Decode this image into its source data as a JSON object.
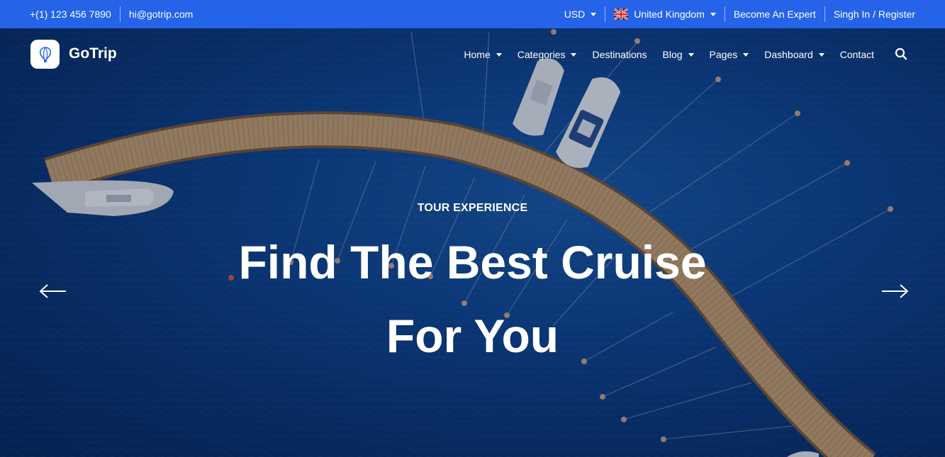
{
  "topbar": {
    "phone": "+(1) 123 456 7890",
    "email": "hi@gotrip.com",
    "currency": "USD",
    "country": "United Kingdom",
    "become_expert": "Become An Expert",
    "signin": "Singh In / Register"
  },
  "nav": {
    "brand": "GoTrip",
    "items": [
      {
        "label": "Home",
        "dropdown": true
      },
      {
        "label": "Categories",
        "dropdown": true
      },
      {
        "label": "Destinations",
        "dropdown": false
      },
      {
        "label": "Blog",
        "dropdown": true
      },
      {
        "label": "Pages",
        "dropdown": true
      },
      {
        "label": "Dashboard",
        "dropdown": true
      },
      {
        "label": "Contact",
        "dropdown": false
      }
    ],
    "search_icon": "search-icon"
  },
  "hero": {
    "subtitle": "TOUR EXPERIENCE",
    "title_line1": "Find The Best Cruise",
    "title_line2": "For You",
    "prev_icon": "arrow-left-icon",
    "next_icon": "arrow-right-icon"
  },
  "colors": {
    "topbar": "#2563e8",
    "water": "#0f4690",
    "pier": "#c9a273",
    "text": "#ffffff"
  }
}
